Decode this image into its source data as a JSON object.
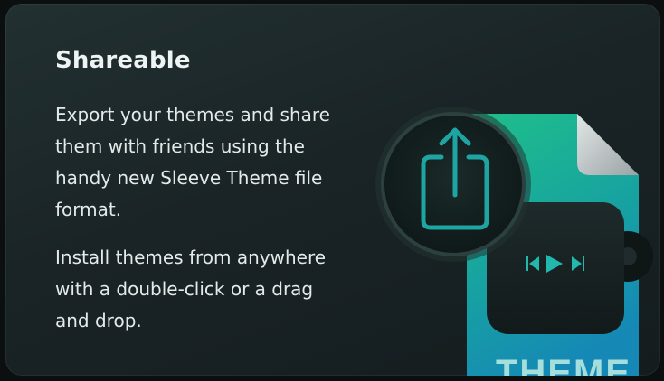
{
  "feature": {
    "title": "Shareable",
    "paragraphs": [
      "Export your themes and share them with friends using the handy new Sleeve Theme file format.",
      "Install themes from anywhere with a double-click or a drag and drop."
    ]
  },
  "illustration": {
    "file_label": "THEME",
    "icons": [
      "share-icon",
      "theme-file-icon",
      "previous-track-icon",
      "play-icon",
      "next-track-icon"
    ]
  },
  "colors": {
    "card_background": "#1c2628",
    "accent_teal": "#1fa6a0",
    "file_green": "#22b394",
    "text": "#e3eaea"
  }
}
